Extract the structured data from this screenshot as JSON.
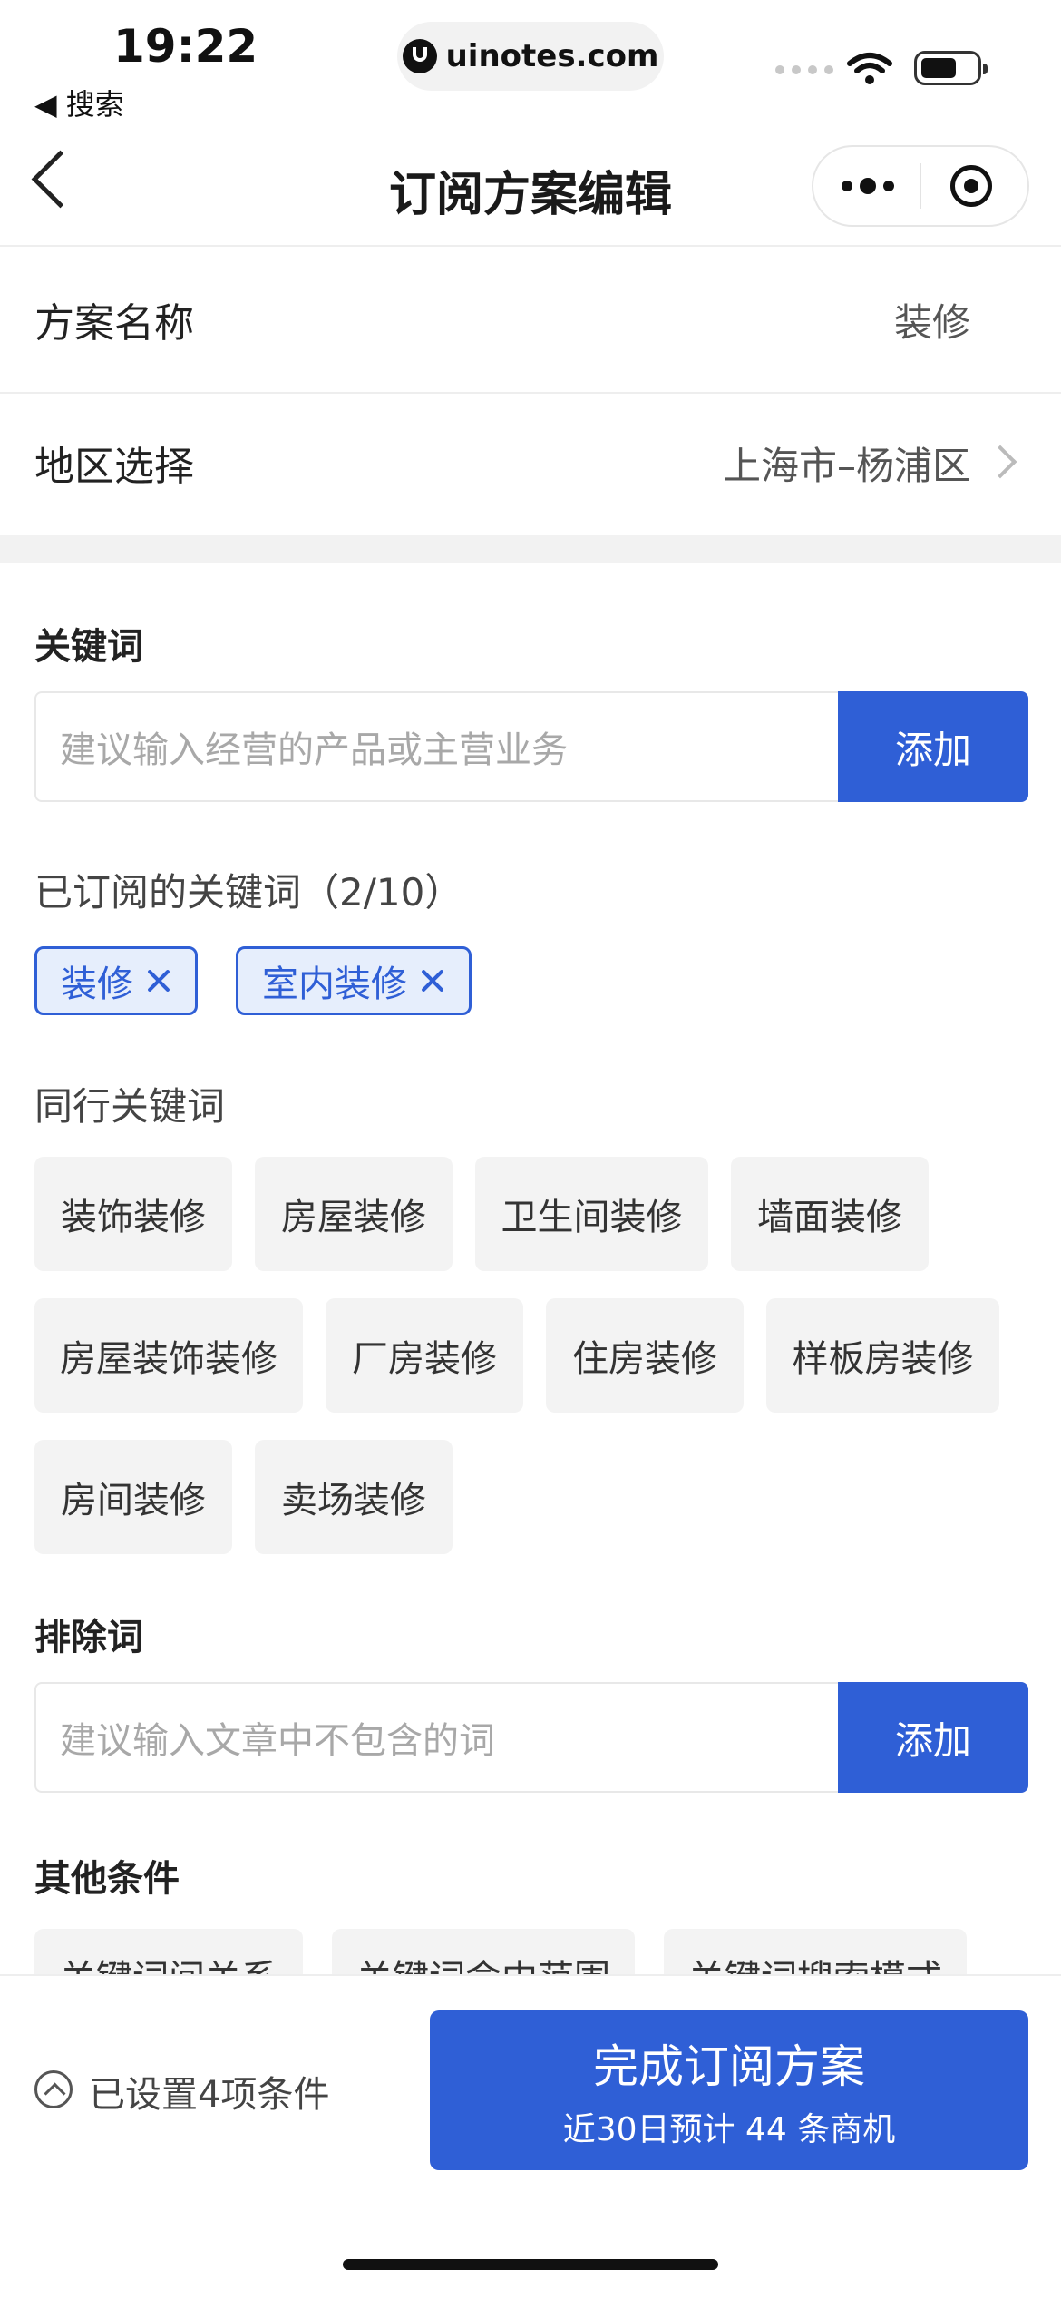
{
  "status_bar": {
    "time": "19:22",
    "back_app": "◀ 搜索",
    "url": "uinotes.com"
  },
  "nav": {
    "title": "订阅方案编辑"
  },
  "rows": [
    {
      "label": "方案名称",
      "value": "装修"
    },
    {
      "label": "地区选择",
      "value": "上海市–杨浦区"
    }
  ],
  "keywords": {
    "title": "关键词",
    "placeholder": "建议输入经营的产品或主营业务",
    "add_label": "添加",
    "subscribed_title": "已订阅的关键词（2/10）",
    "subscribed": [
      "装修",
      "室内装修"
    ],
    "peer_title": "同行关键词",
    "peer": [
      "装饰装修",
      "房屋装修",
      "卫生间装修",
      "墙面装修",
      "房屋装饰装修",
      "厂房装修",
      "住房装修",
      "样板房装修",
      "房间装修",
      "卖场装修"
    ]
  },
  "exclude": {
    "title": "排除词",
    "placeholder": "建议输入文章中不包含的词",
    "add_label": "添加"
  },
  "other": {
    "title": "其他条件",
    "chips": [
      "关键词间关系",
      "关键词命中范围",
      "关键词搜索模式"
    ]
  },
  "bottom": {
    "conditions": "已设置4项条件",
    "done_main": "完成订阅方案",
    "done_sub": "近30日预计 44 条商机"
  },
  "colors": {
    "accent": "#2f5fd6",
    "chip_bg": "#f3f3f3",
    "selected_bg": "#e6eefc"
  }
}
